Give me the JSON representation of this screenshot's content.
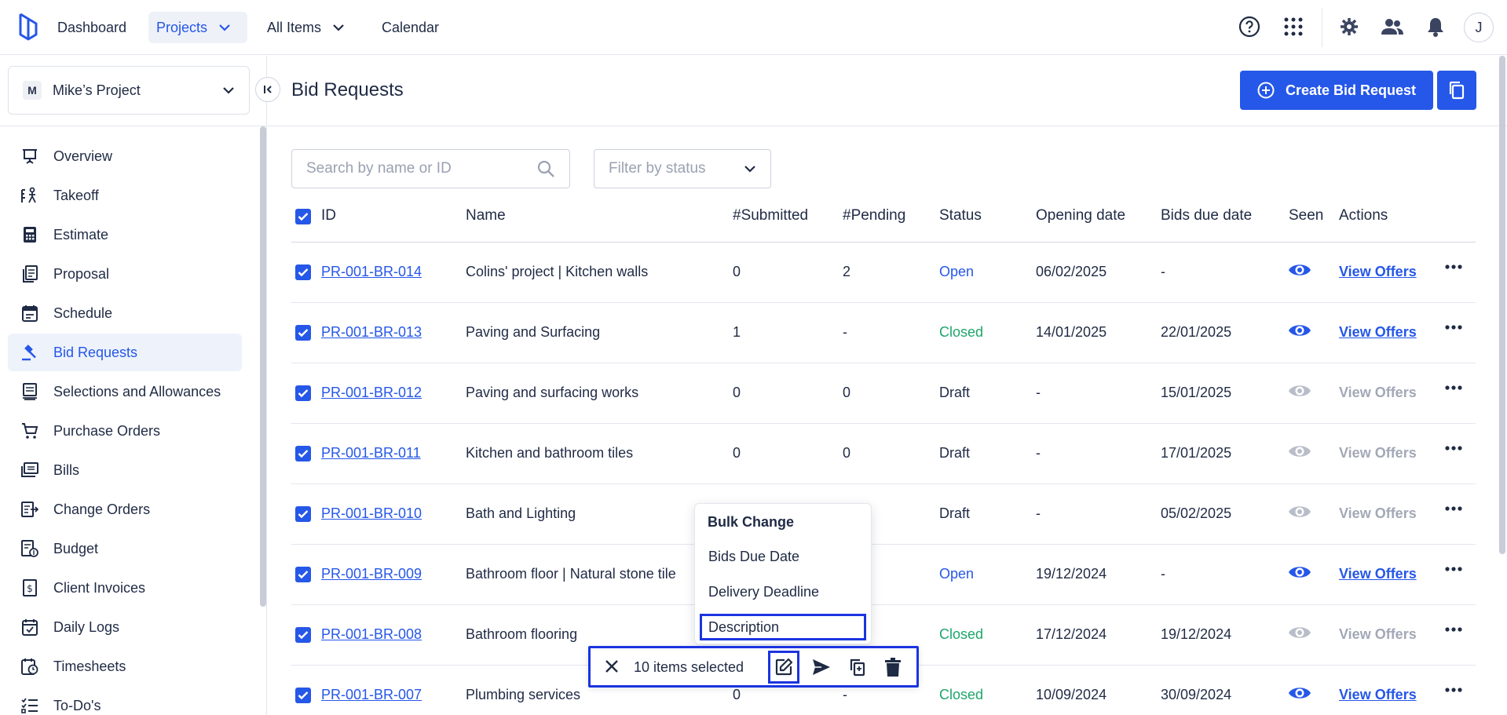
{
  "topnav": {
    "items": [
      {
        "label": "Dashboard"
      },
      {
        "label": "Projects"
      },
      {
        "label": "All Items"
      },
      {
        "label": "Calendar"
      }
    ],
    "avatar_initial": "J"
  },
  "sidebar": {
    "project_badge": "M",
    "project_name": "Mike’s Project",
    "items": [
      {
        "label": "Overview",
        "icon": "presentation-icon"
      },
      {
        "label": "Takeoff",
        "icon": "takeoff-icon"
      },
      {
        "label": "Estimate",
        "icon": "calculator-icon"
      },
      {
        "label": "Proposal",
        "icon": "proposal-icon"
      },
      {
        "label": "Schedule",
        "icon": "calendar-icon"
      },
      {
        "label": "Bid Requests",
        "icon": "gavel-icon"
      },
      {
        "label": "Selections and Allowances",
        "icon": "selections-icon"
      },
      {
        "label": "Purchase Orders",
        "icon": "cart-icon"
      },
      {
        "label": "Bills",
        "icon": "bills-icon"
      },
      {
        "label": "Change Orders",
        "icon": "change-orders-icon"
      },
      {
        "label": "Budget",
        "icon": "budget-icon"
      },
      {
        "label": "Client Invoices",
        "icon": "invoice-icon"
      },
      {
        "label": "Daily Logs",
        "icon": "daily-log-icon"
      },
      {
        "label": "Timesheets",
        "icon": "timesheet-icon"
      },
      {
        "label": "To-Do's",
        "icon": "todo-icon"
      }
    ]
  },
  "page": {
    "title": "Bid Requests",
    "create_label": "Create Bid Request",
    "search_placeholder": "Search by name or ID",
    "filter_placeholder": "Filter by status"
  },
  "table": {
    "headers": {
      "id": "ID",
      "name": "Name",
      "submitted": "#Submitted",
      "pending": "#Pending",
      "status": "Status",
      "opening": "Opening date",
      "due": "Bids due date",
      "seen": "Seen",
      "actions": "Actions"
    },
    "rows": [
      {
        "id": "PR-001-BR-014",
        "name": "Colins' project | Kitchen walls",
        "submitted": "0",
        "pending": "2",
        "status": "Open",
        "opening": "06/02/2025",
        "due": "-",
        "seen": true,
        "action": "View Offers"
      },
      {
        "id": "PR-001-BR-013",
        "name": "Paving and Surfacing",
        "submitted": "1",
        "pending": "-",
        "status": "Closed",
        "opening": "14/01/2025",
        "due": "22/01/2025",
        "seen": true,
        "action": "View Offers"
      },
      {
        "id": "PR-001-BR-012",
        "name": "Paving and surfacing works",
        "submitted": "0",
        "pending": "0",
        "status": "Draft",
        "opening": "-",
        "due": "15/01/2025",
        "seen": false,
        "action": "View Offers"
      },
      {
        "id": "PR-001-BR-011",
        "name": "Kitchen and bathroom tiles",
        "submitted": "0",
        "pending": "0",
        "status": "Draft",
        "opening": "-",
        "due": "17/01/2025",
        "seen": false,
        "action": "View Offers"
      },
      {
        "id": "PR-001-BR-010",
        "name": "Bath and Lighting",
        "submitted": "",
        "pending": "",
        "status": "Draft",
        "opening": "-",
        "due": "05/02/2025",
        "seen": false,
        "action": "View Offers"
      },
      {
        "id": "PR-001-BR-009",
        "name": "Bathroom floor | Natural stone tile",
        "submitted": "",
        "pending": "",
        "status": "Open",
        "opening": "19/12/2024",
        "due": "-",
        "seen": true,
        "action": "View Offers"
      },
      {
        "id": "PR-001-BR-008",
        "name": "Bathroom flooring",
        "submitted": "",
        "pending": "",
        "status": "Closed",
        "opening": "17/12/2024",
        "due": "19/12/2024",
        "seen": false,
        "action": "View Offers"
      },
      {
        "id": "PR-001-BR-007",
        "name": "Plumbing services",
        "submitted": "0",
        "pending": "-",
        "status": "Closed",
        "opening": "10/09/2024",
        "due": "30/09/2024",
        "seen": true,
        "action": "View Offers"
      }
    ]
  },
  "bulk": {
    "title": "Bulk Change",
    "options": [
      "Bids Due Date",
      "Delivery Deadline",
      "Description"
    ],
    "selected_count": "10 items selected"
  },
  "colors": {
    "accent": "#2557e8",
    "open": "#2557e8",
    "closed": "#1ea66b",
    "focus_outline": "#1b34e0"
  }
}
